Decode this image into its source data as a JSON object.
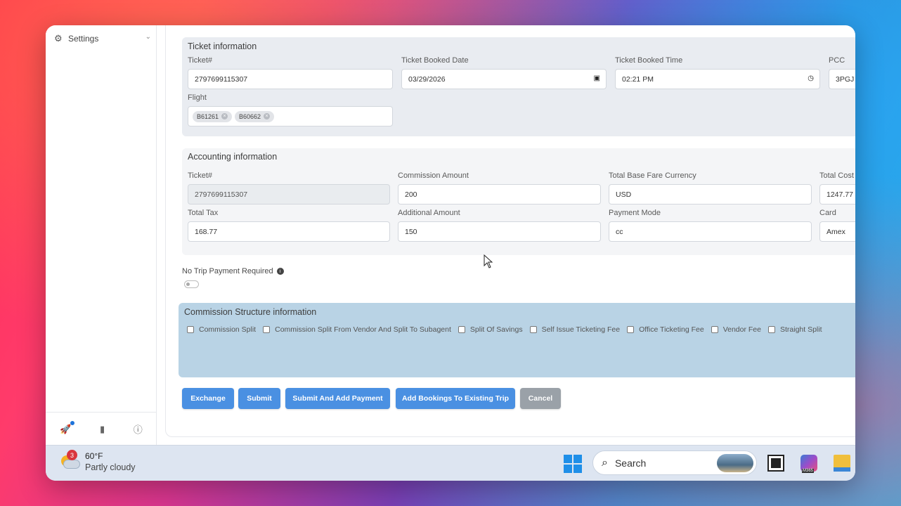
{
  "sidebar": {
    "settings_label": "Settings"
  },
  "ticket_info": {
    "title": "Ticket information",
    "ticket_label": "Ticket#",
    "ticket_value": "2797699115307",
    "booked_date_label": "Ticket Booked Date",
    "booked_date_value": "03/29/2026",
    "booked_time_label": "Ticket Booked Time",
    "booked_time_value": "02:21 PM",
    "pcc_label": "PCC",
    "pcc_value": "3PGJ",
    "flight_label": "Flight",
    "flights": [
      "B61261",
      "B60662"
    ]
  },
  "accounting_info": {
    "title": "Accounting information",
    "ticket_label": "Ticket#",
    "ticket_value": "2797699115307",
    "commission_label": "Commission Amount",
    "commission_value": "200",
    "base_fare_currency_label": "Total Base Fare Currency",
    "base_fare_currency_value": "USD",
    "total_cost_label": "Total Cost",
    "total_cost_value": "1247.77",
    "total_tax_label": "Total Tax",
    "total_tax_value": "168.77",
    "additional_label": "Additional Amount",
    "additional_value": "150",
    "payment_mode_label": "Payment Mode",
    "payment_mode_value": "cc",
    "card_label": "Card",
    "card_value": "Amex"
  },
  "no_trip_payment": {
    "label": "No Trip Payment Required",
    "enabled": false
  },
  "commission_structure": {
    "title": "Commission Structure information",
    "options": [
      "Commission Split",
      "Commission Split From Vendor And Split To Subagent",
      "Split Of Savings",
      "Self Issue Ticketing Fee",
      "Office Ticketing Fee",
      "Vendor Fee",
      "Straight Split"
    ]
  },
  "actions": {
    "exchange": "Exchange",
    "submit": "Submit",
    "submit_add_payment": "Submit And Add Payment",
    "add_bookings": "Add Bookings To Existing Trip",
    "cancel": "Cancel"
  },
  "taskbar": {
    "weather_badge": "3",
    "temperature": "60°F",
    "weather_desc": "Partly cloudy",
    "search_label": "Search"
  },
  "colors": {
    "primary_button": "#4a90e2",
    "cancel_button": "#9aa1a8",
    "commission_panel": "#b9d3e5"
  }
}
